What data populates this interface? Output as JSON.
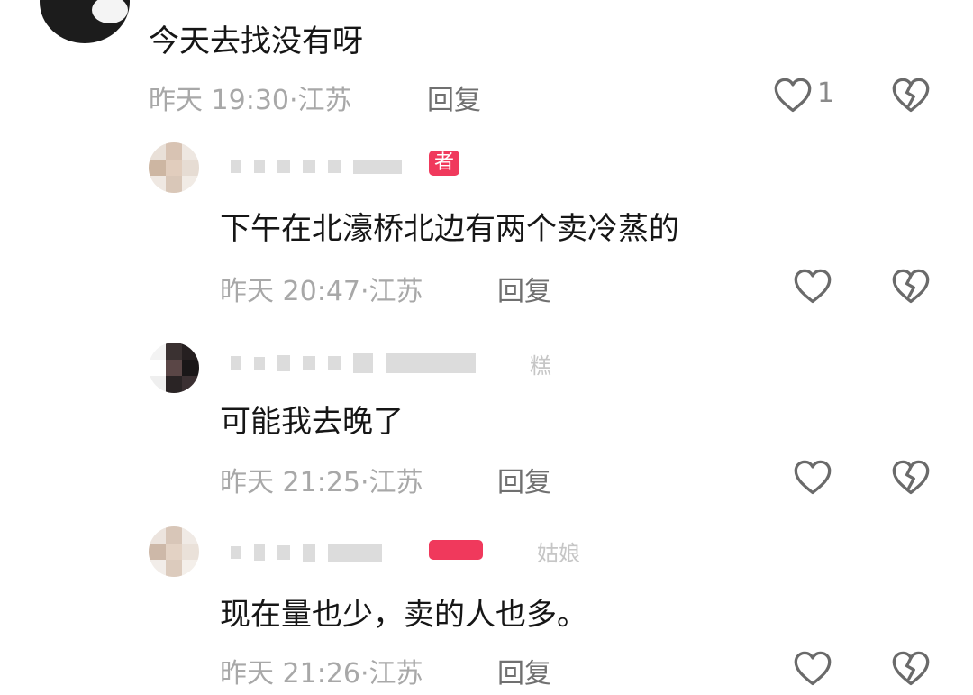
{
  "main_comment": {
    "text": "今天去找没有呀",
    "time": "昨天 19:30",
    "location": "江苏",
    "reply_label": "回复",
    "like_count": "1"
  },
  "replies": [
    {
      "badge": "者",
      "text": "下午在北濠桥北边有两个卖冷蒸的",
      "time": "昨天 20:47",
      "location": "江苏",
      "reply_label": "回复"
    },
    {
      "name_suffix": "糕",
      "text": "可能我去晚了",
      "time": "昨天 21:25",
      "location": "江苏",
      "reply_label": "回复"
    },
    {
      "name_suffix": "姑娘",
      "text": "现在量也少，卖的人也多。",
      "time": "昨天 21:26",
      "location": "江苏",
      "reply_label": "回复"
    }
  ],
  "icons": {
    "like": "heart-outline-icon",
    "dislike": "broken-heart-icon"
  },
  "colors": {
    "badge": "#f0395c",
    "meta_text": "#a8a8a8",
    "body_text": "#161616"
  }
}
